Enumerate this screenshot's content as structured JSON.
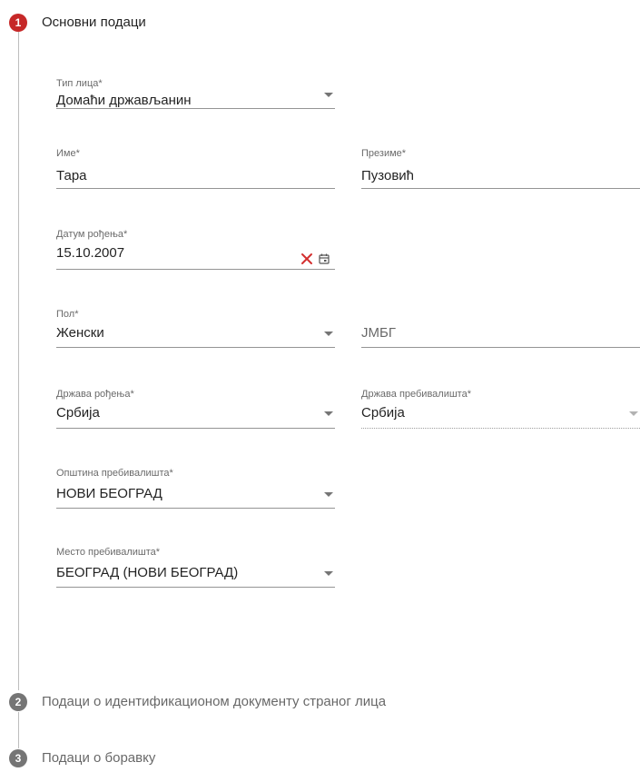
{
  "colors": {
    "active_step": "#c62828",
    "inactive_step": "#757575",
    "clear_icon": "#d32f2f"
  },
  "steps": [
    {
      "number": "1",
      "title": "Основни подаци"
    },
    {
      "number": "2",
      "title": "Подаци о идентификационом документу страног лица"
    },
    {
      "number": "3",
      "title": "Подаци о боравку"
    }
  ],
  "form": {
    "person_type": {
      "label": "Тип лица*",
      "value": "Домаћи држављанин"
    },
    "first_name": {
      "label": "Име*",
      "value": "Тара"
    },
    "last_name": {
      "label": "Презиме*",
      "value": "Пузовић"
    },
    "birth_date": {
      "label": "Датум рођења*",
      "value": "15.10.2007"
    },
    "gender": {
      "label": "Пол*",
      "value": "Женски"
    },
    "jmbg": {
      "placeholder": "ЈМБГ"
    },
    "birth_country": {
      "label": "Држава рођења*",
      "value": "Србија"
    },
    "residence_country": {
      "label": "Држава пребивалишта*",
      "value": "Србија"
    },
    "residence_municipality": {
      "label": "Општина пребивалишта*",
      "value": "НОВИ БЕОГРАД"
    },
    "residence_place": {
      "label": "Место пребивалишта*",
      "value": "БЕОГРАД (НОВИ БЕОГРАД)"
    }
  }
}
